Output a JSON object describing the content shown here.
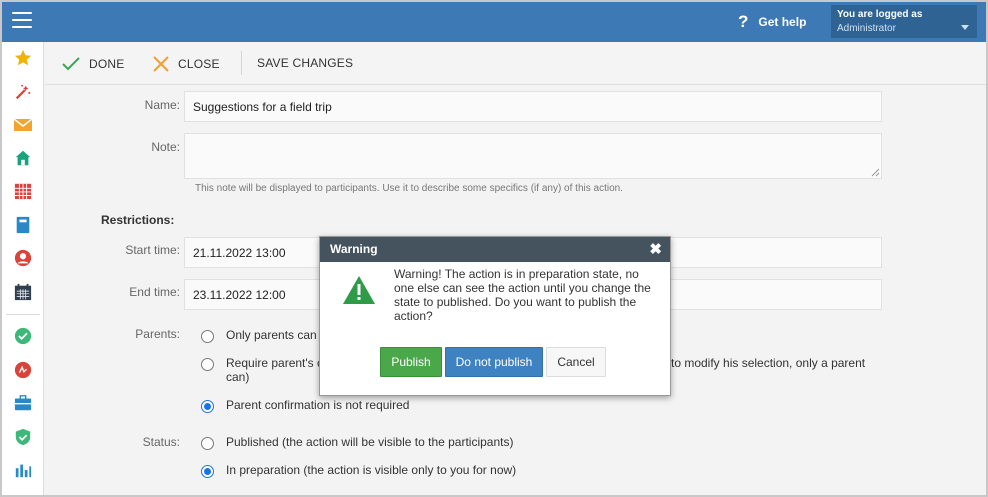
{
  "header": {
    "help_label": "Get help",
    "login_title": "You are logged as",
    "login_user": "Administrator"
  },
  "sidebar": {
    "icons": [
      "star-icon",
      "magic-wand-icon",
      "envelope-icon",
      "home-icon",
      "calendar-grid-icon",
      "book-icon",
      "user-icon",
      "calendar-icon",
      "check-circle-icon",
      "sign-icon",
      "briefcase-icon",
      "shield-check-icon",
      "bar-chart-icon"
    ]
  },
  "toolbar": {
    "done_label": "DONE",
    "close_label": "CLOSE",
    "save_label": "SAVE CHANGES"
  },
  "form": {
    "name_label": "Name:",
    "name_value": "Suggestions for a field trip",
    "note_label": "Note:",
    "note_value": "",
    "note_help": "This note will be displayed to participants. Use it to describe some specifics (if any) of this action.",
    "restrictions_label": "Restrictions:",
    "start_label": "Start time:",
    "start_value": "21.11.2022 13:00",
    "end_label": "End time:",
    "end_value": "23.11.2022 12:00",
    "parents_label": "Parents:",
    "parents_options": [
      {
        "label": "Only parents can",
        "selected": false
      },
      {
        "label": "Require parent's c",
        "label_tail": "to modify his selection, only a parent",
        "label_line2": "can)",
        "selected": false
      },
      {
        "label": "Parent confirmation is not required",
        "selected": true
      }
    ],
    "status_label": "Status:",
    "status_options": [
      {
        "label": "Published (the action will be visible to the participants)",
        "selected": false
      },
      {
        "label": "In preparation (the action is visible only to you for now)",
        "selected": true
      }
    ]
  },
  "dialog": {
    "title": "Warning",
    "message": "Warning! The action is in preparation state, no one else can see the action until you change the state to published. Do you want to publish the action?",
    "publish_label": "Publish",
    "not_publish_label": "Do not publish",
    "cancel_label": "Cancel"
  },
  "colors": {
    "header": "#3d7ab5",
    "dialog_header": "#44535e",
    "publish": "#4aa84a",
    "not_publish": "#3f82c2",
    "warning": "#2e9b47",
    "radio_selected": "#1a73e8"
  }
}
